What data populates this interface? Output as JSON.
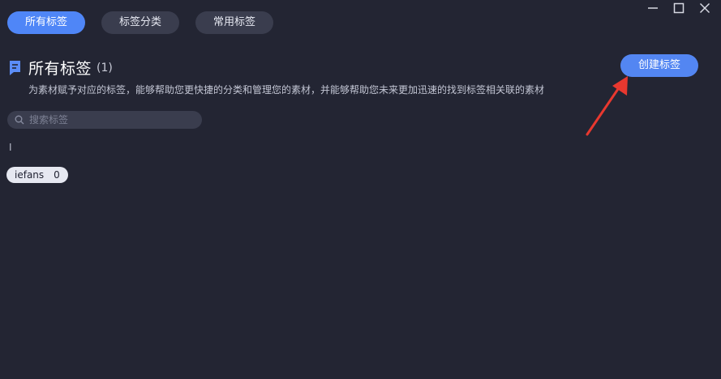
{
  "tabs": [
    {
      "label": "所有标签",
      "active": true
    },
    {
      "label": "标签分类",
      "active": false
    },
    {
      "label": "常用标签",
      "active": false
    }
  ],
  "window_controls": [
    "minimize-icon",
    "maximize-icon",
    "close-icon"
  ],
  "header": {
    "title": "所有标签",
    "count": "(1)",
    "subtitle": "为素材赋予对应的标签，能够帮助您更快捷的分类和管理您的素材，并能够帮助您未来更加迅速的找到标签相关联的素材",
    "icon": "tag-list-icon"
  },
  "actions": {
    "create_label": "创建标签"
  },
  "search": {
    "placeholder": "搜索标签",
    "value": ""
  },
  "group": {
    "letter": "I"
  },
  "tags": [
    {
      "name": "iefans",
      "count": "0"
    }
  ],
  "colors": {
    "background": "#232533",
    "accent": "#4f86f7",
    "annotation_arrow": "#e8382f"
  }
}
